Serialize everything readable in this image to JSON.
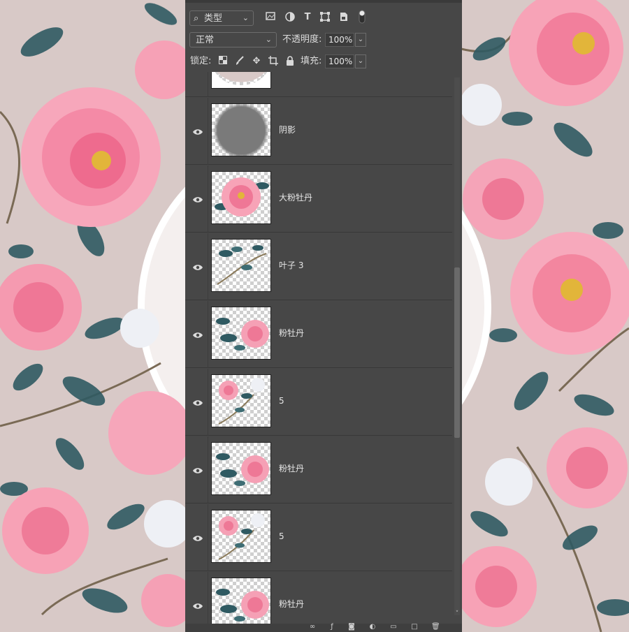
{
  "toolbar": {
    "filter_label": "类型",
    "blend_mode": "正常",
    "opacity_label": "不透明度:",
    "opacity_value": "100%",
    "lock_label": "锁定:",
    "fill_label": "填充:",
    "fill_value": "100%"
  },
  "layers": [
    {
      "name": "",
      "thumb": "plate-edge"
    },
    {
      "name": "阴影",
      "thumb": "shadow-circle"
    },
    {
      "name": "大粉牡丹",
      "thumb": "big-peony"
    },
    {
      "name": "叶子 3",
      "thumb": "leaves-branch"
    },
    {
      "name": "粉牡丹",
      "thumb": "leaves-peony"
    },
    {
      "name": "5",
      "thumb": "peony-branch"
    },
    {
      "name": "粉牡丹",
      "thumb": "leaves-peony"
    },
    {
      "name": "5",
      "thumb": "peony-branch"
    },
    {
      "name": "粉牡丹",
      "thumb": "leaves-peony"
    }
  ],
  "colors": {
    "panel_bg": "#474747",
    "canvas_bg": "#d8c9c7",
    "peony_pink": "#f48aa6",
    "leaf_teal": "#2f5a62"
  }
}
